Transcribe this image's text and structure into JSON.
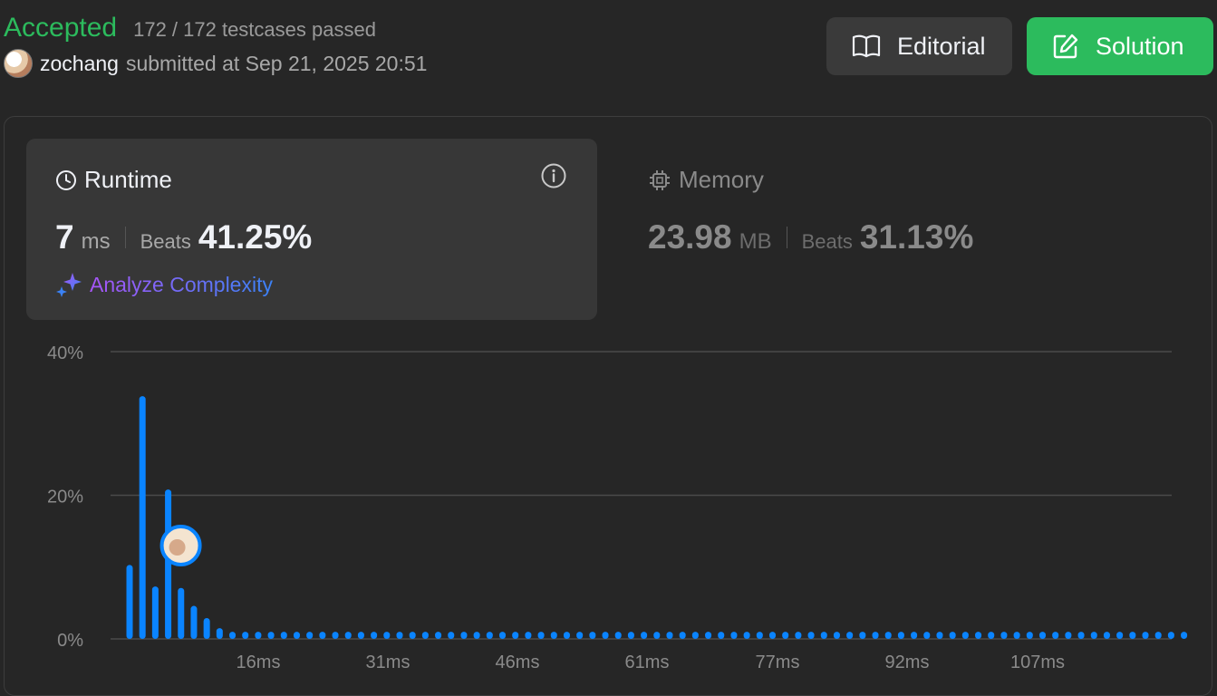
{
  "header": {
    "status": "Accepted",
    "testcases": "172 / 172 testcases passed",
    "username": "zochang",
    "submitted": "submitted at Sep 21, 2025 20:51"
  },
  "buttons": {
    "editorial": "Editorial",
    "solution": "Solution"
  },
  "runtime": {
    "title": "Runtime",
    "value": "7",
    "unit": "ms",
    "beats_label": "Beats",
    "beats_value": "41.25%",
    "analyze": "Analyze Complexity"
  },
  "memory": {
    "title": "Memory",
    "value": "23.98",
    "unit": "MB",
    "beats_label": "Beats",
    "beats_value": "31.13%"
  },
  "colors": {
    "accent": "#2cbb5d",
    "bar": "#0a84ff",
    "muted": "#8a8a8a"
  },
  "chart_data": {
    "type": "bar",
    "y_ticks": [
      "0%",
      "20%",
      "40%"
    ],
    "x_tick_labels": [
      "16ms",
      "31ms",
      "46ms",
      "61ms",
      "77ms",
      "92ms",
      "107ms"
    ],
    "ylim": [
      0,
      40
    ],
    "grid": true,
    "highlight_runtime_ms": 7,
    "values": [
      10.3,
      33.8,
      7.3,
      20.8,
      7.1,
      4.6,
      2.9,
      1.5,
      1,
      1,
      1,
      1,
      1,
      1,
      1,
      1,
      1,
      1,
      1,
      1,
      1,
      1,
      1,
      1,
      1,
      1,
      1,
      1,
      1,
      1,
      1,
      1,
      1,
      1,
      1,
      1,
      1,
      1,
      1,
      1,
      1,
      1,
      1,
      1,
      1,
      1,
      1,
      1,
      1,
      1,
      1,
      1,
      1,
      1,
      1,
      1,
      1,
      1,
      1,
      1,
      1,
      1,
      1,
      1,
      1,
      1,
      1,
      1,
      1,
      1,
      1,
      1,
      1,
      1,
      1,
      1,
      1,
      1,
      1,
      1,
      1,
      1,
      1
    ]
  }
}
